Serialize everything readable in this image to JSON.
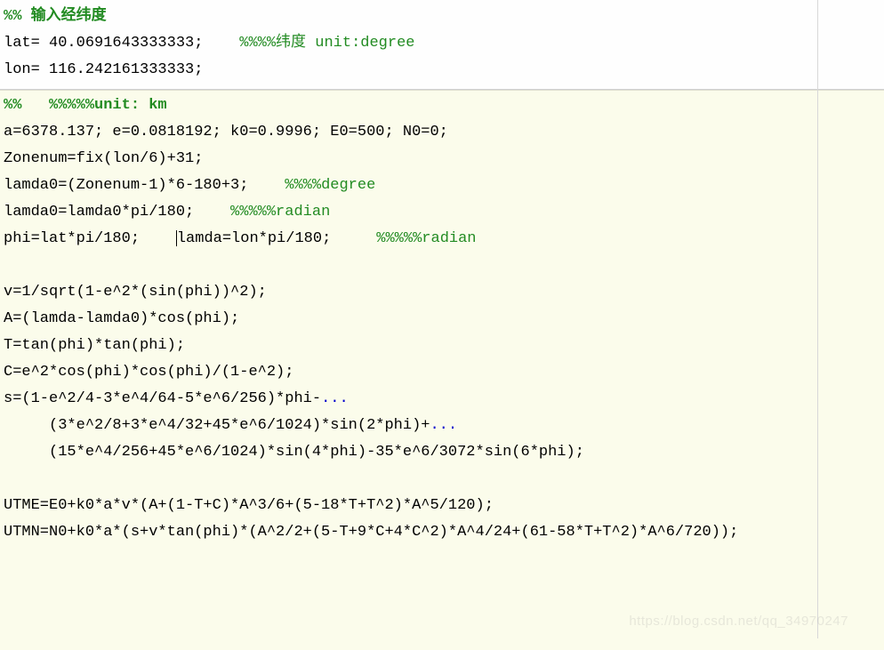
{
  "block1": {
    "l1": {
      "cell": "%% 输入经纬度"
    },
    "l2": {
      "code": "lat= 40.0691643333333;    ",
      "cmt": "%%%%纬度 unit:degree"
    },
    "l3": {
      "code": "lon= 116.242161333333;"
    }
  },
  "block2": {
    "l1": {
      "cell": "%%   %%%%%unit: km"
    },
    "l2": {
      "code": "a=6378.137; e=0.0818192; k0=0.9996; E0=500; N0=0;"
    },
    "l3": {
      "code": "Zonenum=fix(lon/6)+31;"
    },
    "l4": {
      "code": "lamda0=(Zonenum-1)*6-180+3;    ",
      "cmt": "%%%%degree"
    },
    "l5": {
      "code": "lamda0=lamda0*pi/180;    ",
      "cmt": "%%%%%radian"
    },
    "l6": {
      "code_a": "phi=lat*pi/180;    ",
      "code_b": "lamda=lon*pi/180;     ",
      "cmt": "%%%%%radian"
    },
    "l7": {
      "blank": " "
    },
    "l8": {
      "code": "v=1/sqrt(1-e^2*(sin(phi))^2);"
    },
    "l9": {
      "code": "A=(lamda-lamda0)*cos(phi);"
    },
    "l10": {
      "code": "T=tan(phi)*tan(phi);"
    },
    "l11": {
      "code": "C=e^2*cos(phi)*cos(phi)/(1-e^2);"
    },
    "l12": {
      "code": "s=(1-e^2/4-3*e^4/64-5*e^6/256)*phi-",
      "cont": "..."
    },
    "l13": {
      "code": "     (3*e^2/8+3*e^4/32+45*e^6/1024)*sin(2*phi)+",
      "cont": "..."
    },
    "l14": {
      "code": "     (15*e^4/256+45*e^6/1024)*sin(4*phi)-35*e^6/3072*sin(6*phi);"
    },
    "l15": {
      "blank": " "
    },
    "l16": {
      "code": "UTME=E0+k0*a*v*(A+(1-T+C)*A^3/6+(5-18*T+T^2)*A^5/120);"
    },
    "l17": {
      "code": "UTMN=N0+k0*a*(s+v*tan(phi)*(A^2/2+(5-T+9*C+4*C^2)*A^4/24+(61-58*T+T^2)*A^6/720));"
    }
  },
  "watermark": "https://blog.csdn.net/qq_34970247"
}
